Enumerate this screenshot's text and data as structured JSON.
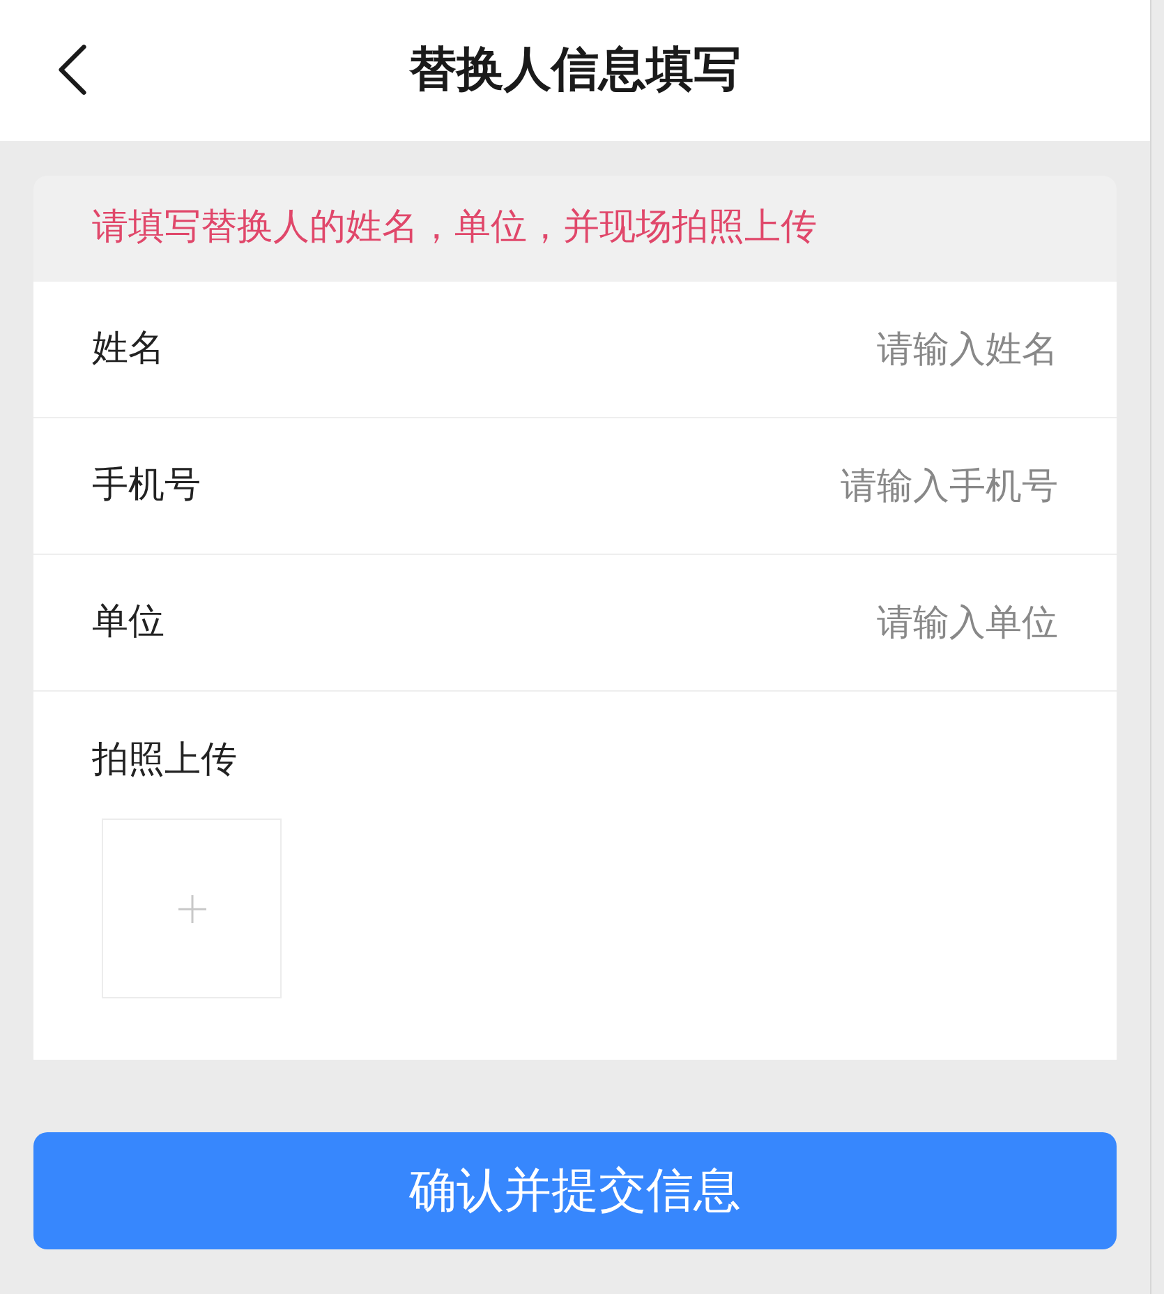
{
  "header": {
    "title": "替换人信息填写"
  },
  "notice": "请填写替换人的姓名，单位，并现场拍照上传",
  "fields": [
    {
      "label": "姓名",
      "placeholder": "请输入姓名"
    },
    {
      "label": "手机号",
      "placeholder": "请输入手机号"
    },
    {
      "label": "单位",
      "placeholder": "请输入单位"
    }
  ],
  "photo_upload": {
    "label": "拍照上传"
  },
  "submit_button": "确认并提交信息"
}
